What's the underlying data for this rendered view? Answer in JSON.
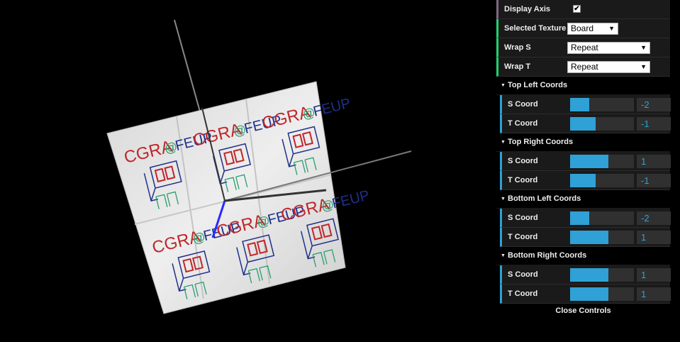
{
  "controls": {
    "display_axis": {
      "label": "Display Axis",
      "checked": "✔"
    },
    "selected_texture": {
      "label": "Selected Texture",
      "value": "Board"
    },
    "wrap_s": {
      "label": "Wrap S",
      "value": "Repeat"
    },
    "wrap_t": {
      "label": "Wrap T",
      "value": "Repeat"
    }
  },
  "folders": [
    {
      "title": "Top Left Coords",
      "s": {
        "label": "S Coord",
        "value": "-2",
        "fill": 0.3
      },
      "t": {
        "label": "T Coord",
        "value": "-1",
        "fill": 0.4
      }
    },
    {
      "title": "Top Right Coords",
      "s": {
        "label": "S Coord",
        "value": "1",
        "fill": 0.6
      },
      "t": {
        "label": "T Coord",
        "value": "-1",
        "fill": 0.4
      }
    },
    {
      "title": "Bottom Left Coords",
      "s": {
        "label": "S Coord",
        "value": "-2",
        "fill": 0.3
      },
      "t": {
        "label": "T Coord",
        "value": "1",
        "fill": 0.6
      }
    },
    {
      "title": "Bottom Right Coords",
      "s": {
        "label": "S Coord",
        "value": "1",
        "fill": 0.6
      },
      "t": {
        "label": "T Coord",
        "value": "1",
        "fill": 0.6
      }
    }
  ],
  "close_label": "Close Controls",
  "texture": {
    "text_a": "CGRA",
    "text_b": "FEUP"
  },
  "colors": {
    "accent": "#2fa1d6",
    "bool": "#806787",
    "option": "#1ed36f"
  }
}
